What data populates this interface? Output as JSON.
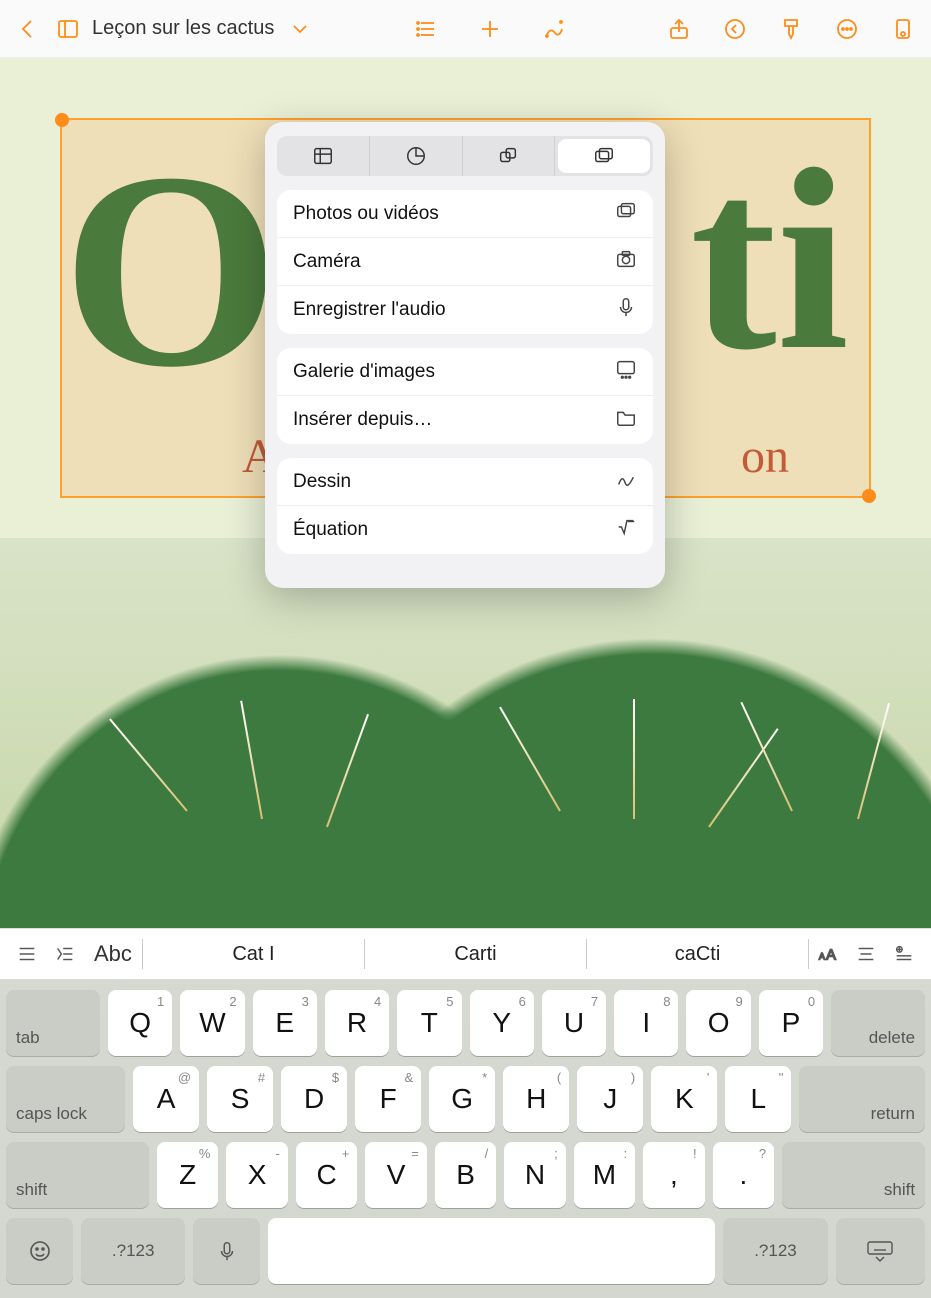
{
  "toolbar": {
    "doc_title": "Leçon sur les cactus"
  },
  "canvas": {
    "big_left": "O",
    "big_right": "ti",
    "sub_left": "A P",
    "sub_right": "on"
  },
  "popover": {
    "group1": {
      "photos": "Photos ou vidéos",
      "camera": "Caméra",
      "audio": "Enregistrer l'audio"
    },
    "group2": {
      "gallery": "Galerie d'images",
      "insert": "Insérer depuis…"
    },
    "group3": {
      "drawing": "Dessin",
      "equation": "Équation"
    }
  },
  "sugbar": {
    "abc": "Abc",
    "s1": "Cat I",
    "s2": "Carti",
    "s3": "caCti"
  },
  "keyboard": {
    "tab": "tab",
    "delete": "delete",
    "caps": "caps lock",
    "return": "return",
    "shift": "shift",
    "numkey": ".?123",
    "row1": [
      {
        "k": "Q",
        "a": "1"
      },
      {
        "k": "W",
        "a": "2"
      },
      {
        "k": "E",
        "a": "3"
      },
      {
        "k": "R",
        "a": "4"
      },
      {
        "k": "T",
        "a": "5"
      },
      {
        "k": "Y",
        "a": "6"
      },
      {
        "k": "U",
        "a": "7"
      },
      {
        "k": "I",
        "a": "8"
      },
      {
        "k": "O",
        "a": "9"
      },
      {
        "k": "P",
        "a": "0"
      }
    ],
    "row2": [
      {
        "k": "A",
        "a": "@"
      },
      {
        "k": "S",
        "a": "#"
      },
      {
        "k": "D",
        "a": "$"
      },
      {
        "k": "F",
        "a": "&"
      },
      {
        "k": "G",
        "a": "*"
      },
      {
        "k": "H",
        "a": "("
      },
      {
        "k": "J",
        "a": ")"
      },
      {
        "k": "K",
        "a": "'"
      },
      {
        "k": "L",
        "a": "\""
      }
    ],
    "row3": [
      {
        "k": "Z",
        "a": "%"
      },
      {
        "k": "X",
        "a": "-"
      },
      {
        "k": "C",
        "a": "+"
      },
      {
        "k": "V",
        "a": "="
      },
      {
        "k": "B",
        "a": "/"
      },
      {
        "k": "N",
        "a": ";"
      },
      {
        "k": "M",
        "a": ":"
      },
      {
        "k": ",",
        "a": "!"
      },
      {
        "k": ".",
        "a": "?"
      }
    ]
  }
}
